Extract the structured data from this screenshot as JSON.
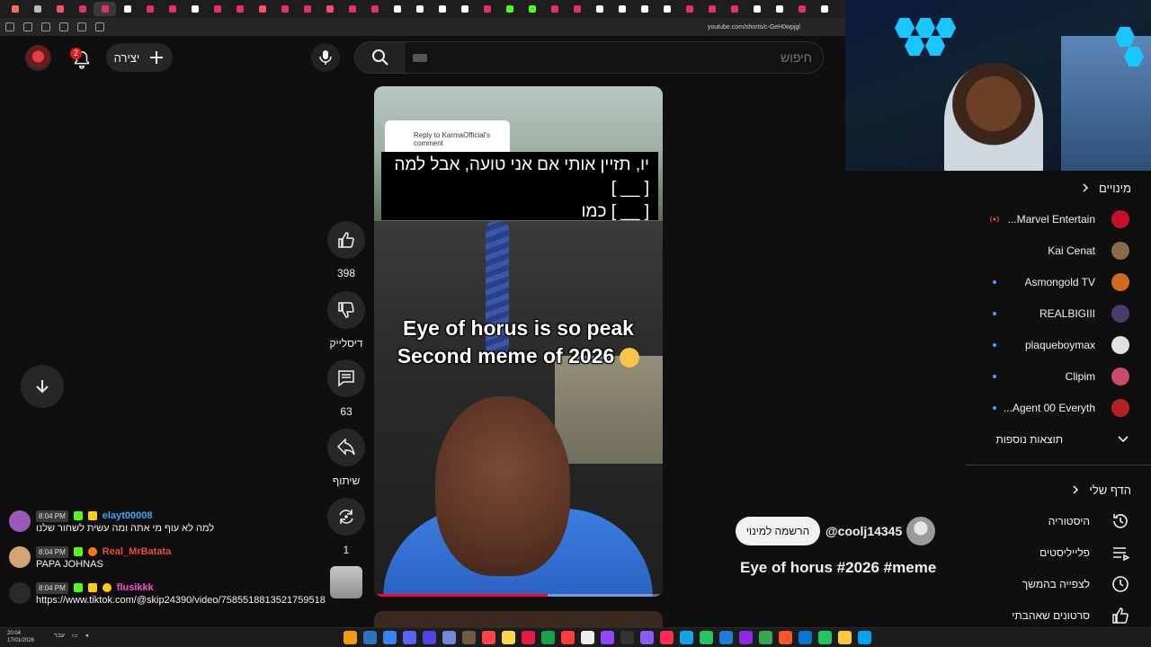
{
  "browser": {
    "url": "youtube.com/shorts/c-GeH0wpjgl",
    "tab_colors": [
      "#ff6b6b",
      "#bbb",
      "#ff4d6d",
      "#e1306c",
      "#e1306c",
      "#ffffff",
      "#e1306c",
      "#e1306c",
      "#ffffff",
      "#e1306c",
      "#e1306c",
      "#ff4d6d",
      "#e1306c",
      "#e1306c",
      "#ff4d6d",
      "#e1306c",
      "#e1306c",
      "#ffffff",
      "#ffffff",
      "#ffffff",
      "#ffffff",
      "#e1306c",
      "#53fc18",
      "#53fc18",
      "#e1306c",
      "#e1306c",
      "#ffffff",
      "#ffffff",
      "#ffffff",
      "#ffffff",
      "#e1306c",
      "#e1306c",
      "#e1306c",
      "#ffffff",
      "#ffffff",
      "#e1306c",
      "#ffffff"
    ]
  },
  "header": {
    "create_label": "יצירה",
    "notifications_count": "2",
    "search_placeholder": "חיפוש"
  },
  "video": {
    "reply_label": "Reply to KarmaOfficial's comment",
    "caption_line1": "יו, תזיין אותי אם אני טועה, אבל למה",
    "caption_line2": "[ __ ]",
    "caption_line3": "[ __ ] כמו",
    "meme_line1": "Eye of horus is so peak",
    "meme_line2": "Second meme of 2026",
    "progress": 0.6
  },
  "actions": {
    "likes": "398",
    "dislike_label": "דיסלייק",
    "comments": "63",
    "share_label": "שיתוף",
    "remix_count": "1"
  },
  "channel": {
    "handle": "@coolj14345",
    "subscribe_label": "הרשמה למינוי",
    "title": "Eye of horus #2026 #meme"
  },
  "sidebar": {
    "subscriptions_title": "מינויים",
    "subscriptions": [
      {
        "name": "Marvel Entertain...",
        "color": "#c8102e",
        "indicator": "live"
      },
      {
        "name": "Kai Cenat",
        "color": "#8a6a4a",
        "indicator": ""
      },
      {
        "name": "Asmongold TV",
        "color": "#d2691e",
        "indicator": "dot"
      },
      {
        "name": "REALBIGIII",
        "color": "#4b3b6b",
        "indicator": "dot"
      },
      {
        "name": "plaqueboymax",
        "color": "#e0e0e0",
        "indicator": "dot"
      },
      {
        "name": "Clipim",
        "color": "#c94a6a",
        "indicator": "dot"
      },
      {
        "name": "Agent 00 Everyth...",
        "color": "#b22222",
        "indicator": "dot"
      }
    ],
    "show_more": "תוצאות נוספות",
    "you_title": "הדף שלי",
    "you_items": [
      {
        "label": "היסטוריה",
        "icon": "history-icon"
      },
      {
        "label": "פלייליסטים",
        "icon": "playlists-icon"
      },
      {
        "label": "לצפייה בהמשך",
        "icon": "watch-later-icon"
      },
      {
        "label": "סרטונים שאהבתי",
        "icon": "liked-videos-icon"
      }
    ]
  },
  "chat": [
    {
      "time": "8:04 PM",
      "user": "elayt00008",
      "user_color": "#3ea6ff",
      "avatar_color": "#9b59b6",
      "message": "למה לא עוף מי אתה ומה עשית לשחור שלנו"
    },
    {
      "time": "8:04 PM",
      "user": "Real_MrBatata",
      "user_color": "#e74c3c",
      "avatar_color": "#d4a574",
      "message": "PAPA JOHNAS"
    },
    {
      "time": "8:04 PM",
      "user": "flusikkk",
      "user_color": "#ff4dd2",
      "avatar_color": "#1c1c1c",
      "message": "https://www.tiktok.com/@skip24390/video/7585518813521759518"
    }
  ],
  "taskbar": {
    "time": "20:04",
    "date": "17/01/2026",
    "lang": "עבר",
    "app_colors": [
      "#f39c12",
      "#2a75bb",
      "#3b82f6",
      "#5865f2",
      "#4f46e5",
      "#7289da",
      "#6d5c43",
      "#ff4444",
      "#ffd54a",
      "#e11d48",
      "#16a34a",
      "#ff3b3b",
      "#eee",
      "#9146ff",
      "#333",
      "#8b5cf6",
      "#ff2d55",
      "#0ea5e9",
      "#22c55e",
      "#1c7ed6",
      "#8a2be2",
      "#34a853",
      "#fb542b",
      "#0078d4",
      "#22c55e",
      "#ffc83d",
      "#00a4ef"
    ]
  }
}
